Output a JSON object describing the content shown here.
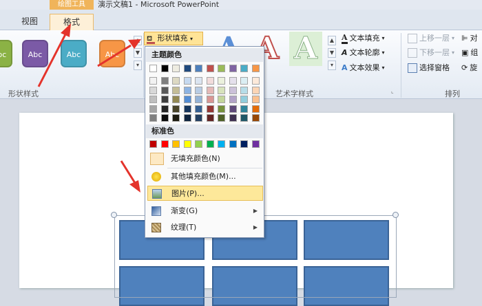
{
  "window": {
    "context_tab_group": "绘图工具",
    "title": "演示文稿1 - Microsoft PowerPoint"
  },
  "tabs": {
    "view": "视图",
    "format": "格式"
  },
  "ribbon": {
    "shape_styles": {
      "sample_label": "Abc",
      "group_label": "形状样式",
      "swatch_colors": [
        "#8bb245",
        "#7b5aa6",
        "#4bacc6",
        "#f79646"
      ]
    },
    "shape_fill_label": "形状填充",
    "text_fill_label": "文本填充",
    "text_outline_label": "文本轮廓",
    "text_effects_label": "文本效果",
    "wordart_letter": "A",
    "wordart_group_label": "艺术字样式",
    "bring_forward_label": "上移一层",
    "send_backward_label": "下移一层",
    "selection_pane_label": "选择窗格",
    "arrange_group_label": "排列",
    "align_label": "对",
    "group_label_short": "组",
    "rotate_label": "旋"
  },
  "dropdown": {
    "theme_colors_header": "主题颜色",
    "standard_colors_header": "标准色",
    "no_fill": "无填充颜色(N)",
    "more_colors": "其他填充颜色(M)...",
    "picture": "图片(P)...",
    "gradient": "渐变(G)",
    "texture": "纹理(T)",
    "theme_top_row": [
      "#ffffff",
      "#000000",
      "#eeece1",
      "#1f497d",
      "#4f81bd",
      "#c0504d",
      "#9bbb59",
      "#8064a2",
      "#4bacc6",
      "#f79646"
    ],
    "theme_shades": [
      [
        "#f2f2f2",
        "#7f7f7f",
        "#ddd9c3",
        "#c6d9f0",
        "#dbe5f1",
        "#f2dcdb",
        "#ebf1dd",
        "#e5e0ec",
        "#dbeef3",
        "#fdeada"
      ],
      [
        "#d8d8d8",
        "#595959",
        "#c4bd97",
        "#8db3e2",
        "#b8cce4",
        "#e5b9b7",
        "#d7e3bc",
        "#ccc1d9",
        "#b7dde8",
        "#fbd5b5"
      ],
      [
        "#bfbfbf",
        "#3f3f3f",
        "#938953",
        "#548dd4",
        "#95b3d7",
        "#d99694",
        "#c3d69b",
        "#b2a2c7",
        "#92cddc",
        "#fac08f"
      ],
      [
        "#a5a5a5",
        "#262626",
        "#494429",
        "#17365d",
        "#366092",
        "#953734",
        "#76923c",
        "#5f497a",
        "#31859b",
        "#e36c09"
      ],
      [
        "#7f7f7f",
        "#0c0c0c",
        "#1d1b10",
        "#0f243e",
        "#244061",
        "#632423",
        "#4f6128",
        "#3f3151",
        "#205867",
        "#974806"
      ]
    ],
    "standard_colors": [
      "#c00000",
      "#ff0000",
      "#ffc000",
      "#ffff00",
      "#92d050",
      "#00b050",
      "#00b0f0",
      "#0070c0",
      "#002060",
      "#7030a0"
    ]
  },
  "slide": {
    "table_fill": "#4f81bd"
  },
  "icons": [
    "paint-bucket-icon",
    "smiley-icon",
    "picture-icon",
    "gradient-icon",
    "texture-icon"
  ]
}
